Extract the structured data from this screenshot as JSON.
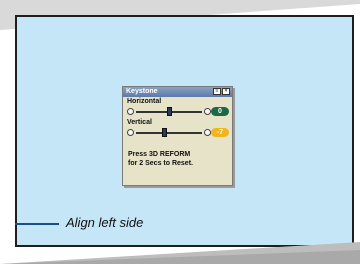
{
  "osd": {
    "title": "Keystone",
    "horizontal": {
      "label": "Horizontal",
      "value": "0",
      "fraction": 0.5
    },
    "vertical": {
      "label": "Vertical",
      "value": "-7",
      "fraction": 0.42
    },
    "note_line1": "Press 3D REFORM",
    "note_line2": "for 2 Secs to Reset."
  },
  "callout": {
    "text": "Align left side"
  },
  "colors": {
    "screen": "#c4e6f7",
    "title_bar": "#5c79a8",
    "horizontal_value": "#1a6a45",
    "vertical_value": "#f2b51d",
    "callout_line": "#1b4e8c"
  }
}
